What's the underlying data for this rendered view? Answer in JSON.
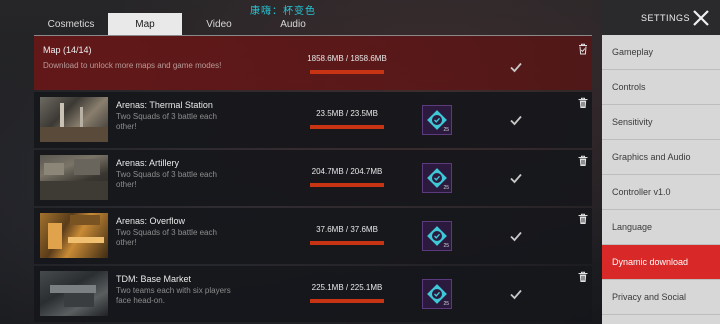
{
  "watermark": "康嗨：杯变色",
  "tabs": [
    {
      "label": "Cosmetics",
      "active": false
    },
    {
      "label": "Map",
      "active": true
    },
    {
      "label": "Video",
      "active": false
    },
    {
      "label": "Audio",
      "active": false
    }
  ],
  "header": {
    "title": "Map (14/14)",
    "subtitle": "Download to unlock more maps and game modes!",
    "size": "1858.6MB / 1858.6MB",
    "progress": 1.0,
    "icon": "trash-check-icon"
  },
  "maps": [
    {
      "title": "Arenas: Thermal Station",
      "desc": "Two Squads of 3 battle each other!",
      "size": "23.5MB / 23.5MB",
      "progress": 1.0,
      "badge_num": "25"
    },
    {
      "title": "Arenas: Artillery",
      "desc": "Two Squads of 3 battle each other!",
      "size": "204.7MB / 204.7MB",
      "progress": 1.0,
      "badge_num": "25"
    },
    {
      "title": "Arenas: Overflow",
      "desc": "Two Squads of 3 battle each other!",
      "size": "37.6MB / 37.6MB",
      "progress": 1.0,
      "badge_num": "25"
    },
    {
      "title": "TDM: Base Market",
      "desc": "Two teams each with six players face head-on.",
      "size": "225.1MB / 225.1MB",
      "progress": 1.0,
      "badge_num": "25"
    }
  ],
  "sidebar": {
    "title": "SETTINGS",
    "close_icon": "close-x-icon",
    "items": [
      {
        "label": "Gameplay",
        "active": false
      },
      {
        "label": "Controls",
        "active": false
      },
      {
        "label": "Sensitivity",
        "active": false
      },
      {
        "label": "Graphics and Audio",
        "active": false
      },
      {
        "label": "Controller v1.0",
        "active": false
      },
      {
        "label": "Language",
        "active": false
      },
      {
        "label": "Dynamic download",
        "active": true
      },
      {
        "label": "Privacy and Social",
        "active": false
      }
    ]
  },
  "colors": {
    "accent": "#d82828",
    "progress": "#c73414",
    "header_bg": "#6e1616",
    "badge_bg": "#2c1a3e",
    "badge_icon": "#3ec8d6"
  }
}
